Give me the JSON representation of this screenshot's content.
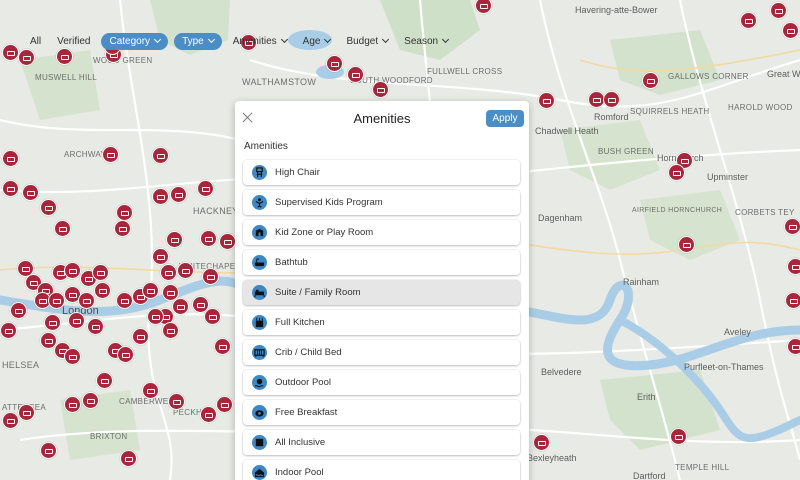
{
  "filters": [
    {
      "label": "All",
      "active": false,
      "dropdown": false
    },
    {
      "label": "Verified",
      "active": false,
      "dropdown": false
    },
    {
      "label": "Category",
      "active": true,
      "dropdown": true
    },
    {
      "label": "Type",
      "active": true,
      "dropdown": true
    },
    {
      "label": "Amenities",
      "active": false,
      "dropdown": true
    },
    {
      "label": "Age",
      "active": false,
      "dropdown": true
    },
    {
      "label": "Budget",
      "active": false,
      "dropdown": true
    },
    {
      "label": "Season",
      "active": false,
      "dropdown": true
    }
  ],
  "modal": {
    "title": "Amenities",
    "apply_label": "Apply",
    "section_title": "Amenities",
    "options": [
      {
        "label": "High Chair",
        "icon": "high-chair-icon"
      },
      {
        "label": "Supervised Kids Program",
        "icon": "kids-program-icon"
      },
      {
        "label": "Kid Zone or Play Room",
        "icon": "play-room-icon"
      },
      {
        "label": "Bathtub",
        "icon": "bathtub-icon"
      },
      {
        "label": "Suite / Family Room",
        "icon": "bed-icon",
        "hovered": true
      },
      {
        "label": "Full Kitchen",
        "icon": "kitchen-icon"
      },
      {
        "label": "Crib / Child Bed",
        "icon": "crib-icon"
      },
      {
        "label": "Outdoor Pool",
        "icon": "outdoor-pool-icon"
      },
      {
        "label": "Free Breakfast",
        "icon": "breakfast-icon"
      },
      {
        "label": "All Inclusive",
        "icon": "all-inclusive-icon"
      },
      {
        "label": "Indoor Pool",
        "icon": "indoor-pool-icon"
      }
    ]
  },
  "map": {
    "labels": [
      {
        "text": "Havering-atte-Bower",
        "style": "med"
      },
      {
        "text": "WALTHAMSTOW",
        "style": "small"
      },
      {
        "text": "SOUTH WOODFORD",
        "style": "small"
      },
      {
        "text": "FULLWELL CROSS",
        "style": "small"
      },
      {
        "text": "MUSWELL HILL",
        "style": "small"
      },
      {
        "text": "ARCHWAY",
        "style": "small"
      },
      {
        "text": "HACKNEY",
        "style": "small"
      },
      {
        "text": "Chadwell Heath",
        "style": "med"
      },
      {
        "text": "Romford",
        "style": "med"
      },
      {
        "text": "GALLOWS CORNER",
        "style": "small"
      },
      {
        "text": "SQUIRRELS HEATH",
        "style": "small"
      },
      {
        "text": "HAROLD WOOD",
        "style": "small"
      },
      {
        "text": "Great W",
        "style": "med"
      },
      {
        "text": "BUSH GREEN",
        "style": "small"
      },
      {
        "text": "Hornchurch",
        "style": "med"
      },
      {
        "text": "Upminster",
        "style": "med"
      },
      {
        "text": "Dagenham",
        "style": "med"
      },
      {
        "text": "AIRFIELD HORNCHURCH",
        "style": "small"
      },
      {
        "text": "CORBETS TEY",
        "style": "small"
      },
      {
        "text": "Rainham",
        "style": "med"
      },
      {
        "text": "Aveley",
        "style": "med"
      },
      {
        "text": "Purfleet-on-Thames",
        "style": "med"
      },
      {
        "text": "Belvedere",
        "style": "med"
      },
      {
        "text": "Erith",
        "style": "med"
      },
      {
        "text": "London",
        "style": "big"
      },
      {
        "text": "HELSEA",
        "style": "small"
      },
      {
        "text": "ATTERSEA",
        "style": "small"
      },
      {
        "text": "CAMBERWELL",
        "style": "small"
      },
      {
        "text": "PECKHAM",
        "style": "small"
      },
      {
        "text": "BRIXTON",
        "style": "small"
      },
      {
        "text": "WHITECHAPEL",
        "style": "small"
      },
      {
        "text": "WOOD GREEN",
        "style": "small"
      },
      {
        "text": "Bexleyheath",
        "style": "med"
      },
      {
        "text": "Dartford",
        "style": "med"
      },
      {
        "text": "TEMPLE HILL",
        "style": "small"
      }
    ]
  },
  "colors": {
    "accent": "#4a8ec5",
    "pin": "#a8263a",
    "icon_bg": "#3d87c5"
  }
}
